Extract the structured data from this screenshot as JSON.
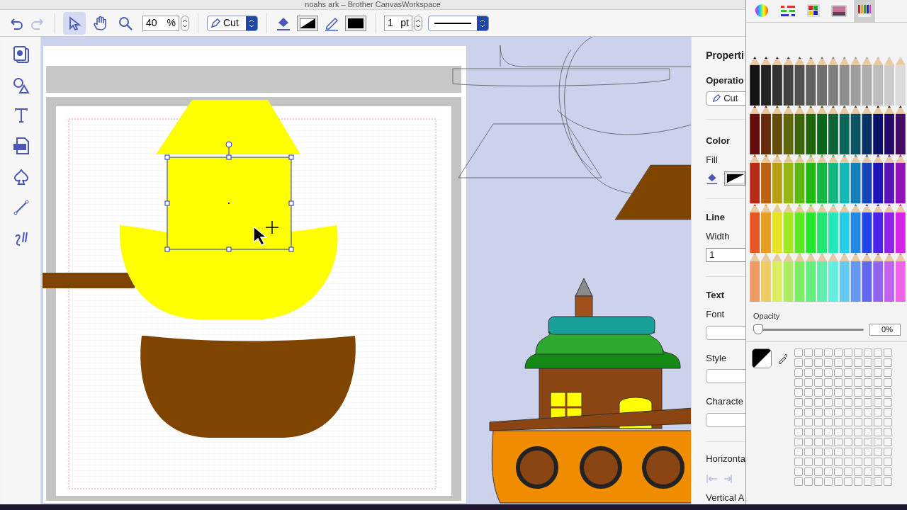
{
  "window": {
    "title": "noahs ark – Brother CanvasWorkspace"
  },
  "toolbar": {
    "tools": [
      {
        "kind": "select",
        "selected": true
      },
      {
        "kind": "hand",
        "selected": false
      },
      {
        "kind": "zoom",
        "selected": false
      }
    ],
    "zoom": {
      "value": "40",
      "unit": "%"
    },
    "operation": "Cut",
    "line_width": {
      "value": "1",
      "unit": "pt"
    }
  },
  "properties": {
    "title": "Properti",
    "operation_label": "Operatio",
    "operation": "Cut",
    "color_heading": "Color",
    "fill_label": "Fill",
    "line_heading": "Line",
    "width_label": "Width",
    "width_value": "1",
    "text_heading": "Text",
    "font_label": "Font",
    "style_label": "Style",
    "character_label": "Characte",
    "horizontal_label": "Horizonta",
    "vertical_label": "Vertical A"
  },
  "color_picker": {
    "tabs": [
      {
        "kind": "wheel",
        "selected": false
      },
      {
        "kind": "sliders",
        "selected": false
      },
      {
        "kind": "palettes",
        "selected": false
      },
      {
        "kind": "image",
        "selected": false
      },
      {
        "kind": "pencils",
        "selected": true
      }
    ],
    "opacity": {
      "label": "Opacity",
      "level": 0,
      "reading": "0%"
    }
  }
}
